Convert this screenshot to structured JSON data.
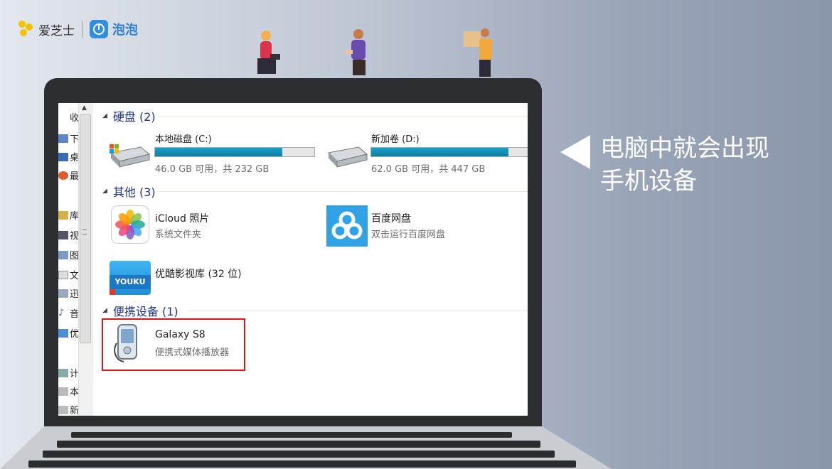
{
  "brand": {
    "name": "爱芝士",
    "partner": "泡泡"
  },
  "explorer": {
    "nav_labels": [
      "收",
      "下",
      "桌",
      "最",
      "库",
      "视",
      "图",
      "文",
      "迅",
      "音",
      "优",
      "计",
      "本",
      "新"
    ],
    "groups": {
      "disks": {
        "header": "硬盘 (2)",
        "items": [
          {
            "name": "本地磁盘 (C:)",
            "space": "46.0 GB 可用，共 232 GB",
            "used_fraction": 0.8
          },
          {
            "name": "新加卷 (D:)",
            "space": "62.0 GB 可用，共 447 GB",
            "used_fraction": 0.86
          }
        ]
      },
      "other": {
        "header": "其他 (3)",
        "items": [
          {
            "name": "iCloud 照片",
            "desc": "系统文件夹"
          },
          {
            "name": "百度网盘",
            "desc": "双击运行百度网盘"
          },
          {
            "name": "优酷影视库 (32 位)",
            "icon_text": "YOUKU"
          }
        ]
      },
      "portable": {
        "header": "便携设备 (1)",
        "items": [
          {
            "name": "Galaxy S8",
            "desc": "便携式媒体播放器"
          }
        ]
      }
    }
  },
  "callout": {
    "line1": "电脑中就会出现",
    "line2": "手机设备"
  },
  "colors": {
    "highlight": "#e0151b",
    "bar_fill": "#1590b6",
    "group_header": "#1e3287",
    "brand_yellow": "#f5c400",
    "brand_blue": "#2f8ee0"
  }
}
